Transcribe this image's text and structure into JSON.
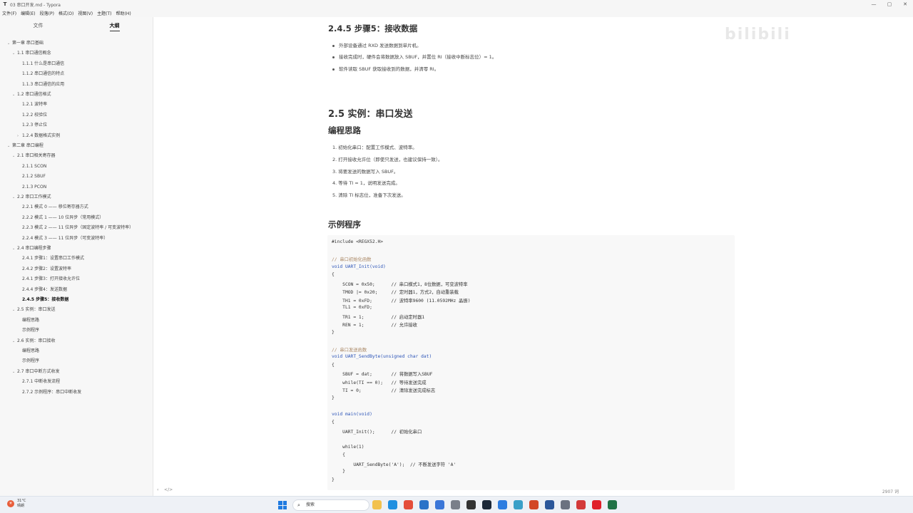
{
  "window": {
    "app_icon": "T",
    "title": "03 串口开发.md - Typora"
  },
  "menubar": [
    "文件(F)",
    "编辑(E)",
    "段落(P)",
    "格式(O)",
    "视图(V)",
    "主题(T)",
    "帮助(H)"
  ],
  "sidebar": {
    "tab_files": "文件",
    "tab_outline": "大纲",
    "outline": [
      {
        "label": "第一章 串口基础",
        "level": 0,
        "arrow": "⌄"
      },
      {
        "label": "1.1 串口通信概念",
        "level": 1,
        "arrow": "⌄"
      },
      {
        "label": "1.1.1 什么是串口通信",
        "level": 2,
        "arrow": ""
      },
      {
        "label": "1.1.2 串口通信的特点",
        "level": 2,
        "arrow": ""
      },
      {
        "label": "1.1.3 串口通信的应用",
        "level": 2,
        "arrow": ""
      },
      {
        "label": "1.2 串口通信格式",
        "level": 1,
        "arrow": "⌄"
      },
      {
        "label": "1.2.1 波特率",
        "level": 2,
        "arrow": ""
      },
      {
        "label": "1.2.2 校验位",
        "level": 2,
        "arrow": ""
      },
      {
        "label": "1.2.3 停止位",
        "level": 2,
        "arrow": ""
      },
      {
        "label": "1.2.4 数据格式实例",
        "level": 2,
        "arrow": "›"
      },
      {
        "label": "第二章 串口编程",
        "level": 0,
        "arrow": "⌄"
      },
      {
        "label": "2.1 串口相关寄存器",
        "level": 1,
        "arrow": "⌄"
      },
      {
        "label": "2.1.1 SCON",
        "level": 2,
        "arrow": ""
      },
      {
        "label": "2.1.2 SBUF",
        "level": 2,
        "arrow": ""
      },
      {
        "label": "2.1.3 PCON",
        "level": 2,
        "arrow": ""
      },
      {
        "label": "2.2 串口工作模式",
        "level": 1,
        "arrow": "⌄"
      },
      {
        "label": "2.2.1 模式 0 —— 移位寄存器方式",
        "level": 2,
        "arrow": ""
      },
      {
        "label": "2.2.2 模式 1 —— 10 位异步（常用模式）",
        "level": 2,
        "arrow": ""
      },
      {
        "label": "2.2.3 模式 2 —— 11 位异步（固定波特率 / 可变波特率）",
        "level": 2,
        "arrow": ""
      },
      {
        "label": "2.2.4 模式 3 —— 11 位异步（可变波特率）",
        "level": 2,
        "arrow": ""
      },
      {
        "label": "2.4 串口编程步骤",
        "level": 1,
        "arrow": "⌄"
      },
      {
        "label": "2.4.1 步骤1：设置串口工作模式",
        "level": 2,
        "arrow": ""
      },
      {
        "label": "2.4.2 步骤2：设置波特率",
        "level": 2,
        "arrow": ""
      },
      {
        "label": "2.4.1 步骤3：打开接收允许位",
        "level": 2,
        "arrow": ""
      },
      {
        "label": "2.4.4 步骤4：发送数据",
        "level": 2,
        "arrow": ""
      },
      {
        "label": "2.4.5 步骤5：接收数据",
        "level": 2,
        "arrow": "",
        "active": true
      },
      {
        "label": "2.5 实例：串口发送",
        "level": 1,
        "arrow": "⌄"
      },
      {
        "label": "编程思路",
        "level": 2,
        "arrow": ""
      },
      {
        "label": "示例程序",
        "level": 2,
        "arrow": ""
      },
      {
        "label": "2.6 实例：串口接收",
        "level": 1,
        "arrow": "⌄"
      },
      {
        "label": "编程思路",
        "level": 2,
        "arrow": ""
      },
      {
        "label": "示例程序",
        "level": 2,
        "arrow": ""
      },
      {
        "label": "2.7 串口中断方式收发",
        "level": 1,
        "arrow": "⌄"
      },
      {
        "label": "2.7.1 中断收发流程",
        "level": 2,
        "arrow": ""
      },
      {
        "label": "2.7.2 示例程序：串口中断收发",
        "level": 2,
        "arrow": ""
      }
    ]
  },
  "document": {
    "h_step5": "2.4.5 步骤5：接收数据",
    "step5_bullets": [
      "外部设备通过 RXD 发送数据到单片机。",
      "接收完成时，硬件会将数据放入 SBUF，并置位 RI（接收中断标志位）= 1。",
      "软件读取 SBUF 获取接收到的数据，并清零 RI。"
    ],
    "h_example": "2.5 实例：串口发送",
    "h_idea": "编程思路",
    "idea_steps": [
      "1. 初始化串口：配置工作模式、波特率。",
      "2. 打开接收允许位（即使只发送，也建议保持一致）。",
      "3. 将要发送的数据写入 SBUF。",
      "4. 等待 TI = 1，说明发送完成。",
      "5. 清除 TI 标志位，准备下次发送。"
    ],
    "h_program": "示例程序",
    "code": [
      {
        "t": "#include <REGX52.H>",
        "k": "plain"
      },
      {
        "t": "",
        "k": "plain"
      },
      {
        "t": "// 串口初始化函数",
        "k": "comment"
      },
      {
        "t": "void UART_Init(void)",
        "k": "fn"
      },
      {
        "t": "{",
        "k": "plain"
      },
      {
        "t": "    SCON = 0x50;      // 串口模式1，8位数据，可变波特率",
        "k": "stmt"
      },
      {
        "t": "    TMOD |= 0x20;     // 定时器1，方式2，自动重装载",
        "k": "stmt"
      },
      {
        "t": "    TH1 = 0xFD;       // 波特率9600 (11.0592MHz 晶振)",
        "k": "stmt"
      },
      {
        "t": "    TL1 = 0xFD;",
        "k": "stmt"
      },
      {
        "t": "    TR1 = 1;          // 启动定时器1",
        "k": "stmt"
      },
      {
        "t": "    REN = 1;          // 允许接收",
        "k": "stmt"
      },
      {
        "t": "}",
        "k": "plain"
      },
      {
        "t": "",
        "k": "plain"
      },
      {
        "t": "// 串口发送函数",
        "k": "comment"
      },
      {
        "t": "void UART_SendByte(unsigned char dat)",
        "k": "fn"
      },
      {
        "t": "{",
        "k": "plain"
      },
      {
        "t": "    SBUF = dat;       // 将数据写入SBUF",
        "k": "stmt"
      },
      {
        "t": "    while(TI == 0);   // 等待发送完成",
        "k": "stmt"
      },
      {
        "t": "    TI = 0;           // 清除发送完成标志",
        "k": "stmt"
      },
      {
        "t": "}",
        "k": "plain"
      },
      {
        "t": "",
        "k": "plain"
      },
      {
        "t": "void main(void)",
        "k": "fn"
      },
      {
        "t": "{",
        "k": "plain"
      },
      {
        "t": "    UART_Init();      // 初始化串口",
        "k": "stmt"
      },
      {
        "t": "",
        "k": "plain"
      },
      {
        "t": "    while(1)",
        "k": "stmt"
      },
      {
        "t": "    {",
        "k": "plain"
      },
      {
        "t": "        UART_SendByte('A');  // 不断发送字符 'A'",
        "k": "stmt"
      },
      {
        "t": "    }",
        "k": "plain"
      },
      {
        "t": "}",
        "k": "plain"
      }
    ]
  },
  "statusbar": {
    "nav_back": "‹",
    "source_toggle": "</>",
    "word_count": "2907 词"
  },
  "taskbar": {
    "weather_temp": "31°C",
    "weather_desc": "晴朗",
    "search_placeholder": "搜索",
    "icons": [
      "file-explorer-icon",
      "edge-icon",
      "chrome-icon",
      "mail-icon",
      "store-icon",
      "settings-icon",
      "typora-icon",
      "steam-icon",
      "app-icon",
      "notepad-icon",
      "powerpoint-icon",
      "word-icon",
      "camera-icon",
      "video-icon",
      "youdao-icon",
      "excel-icon"
    ],
    "colors": {
      "start": "#1f7ae0",
      "weather_badge": "#e85d3a"
    }
  }
}
